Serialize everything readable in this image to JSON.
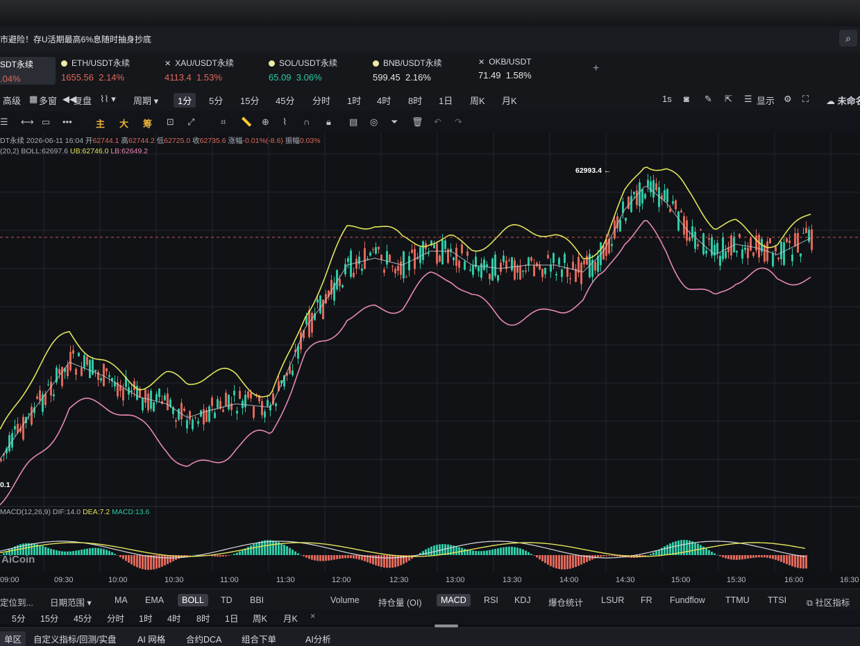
{
  "banner": {
    "text": "市避险！存U活期最高6%息随时抽身抄底"
  },
  "tickers": [
    {
      "name": "SDT永续",
      "price": ".04%",
      "change": "",
      "marker": "none",
      "dir": "red"
    },
    {
      "name": "ETH/USDT永续",
      "price": "1655.56",
      "change": "2.14%",
      "marker": "dot",
      "dir": "red"
    },
    {
      "name": "XAU/USDT永续",
      "price": "4113.4",
      "change": "1.53%",
      "marker": "x",
      "dir": "red"
    },
    {
      "name": "SOL/USDT永续",
      "price": "65.09",
      "change": "3.06%",
      "marker": "dot",
      "dir": "green"
    },
    {
      "name": "BNB/USDT永续",
      "price": "599.45",
      "change": "2.16%",
      "marker": "dot",
      "dir": "white"
    },
    {
      "name": "OKB/USDT",
      "price": "71.49",
      "change": "1.58%",
      "marker": "x",
      "dir": "white"
    }
  ],
  "add_tab": "+",
  "toolbar": {
    "left": [
      "高级",
      "多窗",
      "复盘"
    ],
    "period_label": "周期",
    "periods": [
      "1分",
      "5分",
      "15分",
      "45分",
      "分时",
      "1时",
      "4时",
      "8时",
      "1日",
      "周K",
      "月K"
    ],
    "selected_period": "1分",
    "right_interval": "1s",
    "display_label": "显示",
    "unnamed_label": "未命名"
  },
  "drawing_tools": {
    "main": "主",
    "big": "大",
    "chip": "筹"
  },
  "ohlc": {
    "symbol": "DT永续",
    "datetime": "2026-06-11 16:04",
    "open_label": "开",
    "open": "62744.1",
    "high_label": "高",
    "high": "62744.2",
    "low_label": "低",
    "low": "62725.0",
    "close_label": "收",
    "close": "62735.6",
    "chg_label": "涨幅",
    "chg": "-0.01%(-8.6)",
    "amp_label": "振幅",
    "amp": "0.03%"
  },
  "boll": {
    "params": "(20,2)",
    "mid": "BOLL:62697.6",
    "ub": "UB:62746.0",
    "lb": "LB:62649.2"
  },
  "macd": {
    "params": "MACD(12,26,9)",
    "dif": "DIF:14.0",
    "dea": "DEA:7.2",
    "macd": "MACD:13.6"
  },
  "high_marker": "62993.4",
  "low_marker": "0.1",
  "watermark": "AiCoin",
  "colors": {
    "up": "#2fc9a4",
    "down": "#e0685a",
    "ub": "#e4e45a",
    "lb": "#e889b5",
    "mid": "#c9ccd3",
    "price_line": "#d9534f"
  },
  "time_axis": [
    "09:00",
    "09:30",
    "10:00",
    "10:30",
    "11:00",
    "11:30",
    "12:00",
    "12:30",
    "13:00",
    "13:30",
    "14:00",
    "14:30",
    "15:00",
    "15:30",
    "16:00",
    "16:30"
  ],
  "indicator_bar": {
    "left": [
      "定位到...",
      "日期范围"
    ],
    "main": [
      "MA",
      "EMA",
      "BOLL",
      "TD",
      "BBI"
    ],
    "main_selected": "BOLL",
    "sub": [
      "Volume",
      "持仓量 (OI)",
      "MACD",
      "RSI",
      "KDJ",
      "爆仓统计",
      "LSUR",
      "FR",
      "Fundflow",
      "TTMU",
      "TTSI"
    ],
    "sub_selected": "MACD",
    "community": "社区指标"
  },
  "period_bar": [
    "5分",
    "15分",
    "45分",
    "分时",
    "1时",
    "4时",
    "8时",
    "1日",
    "周K",
    "月K"
  ],
  "period_bar_close": "×",
  "bottom_bar": [
    "单区",
    "自定义指标/回测/实盘",
    "AI 网格",
    "合约DCA",
    "组合下单",
    "AI分析"
  ]
}
